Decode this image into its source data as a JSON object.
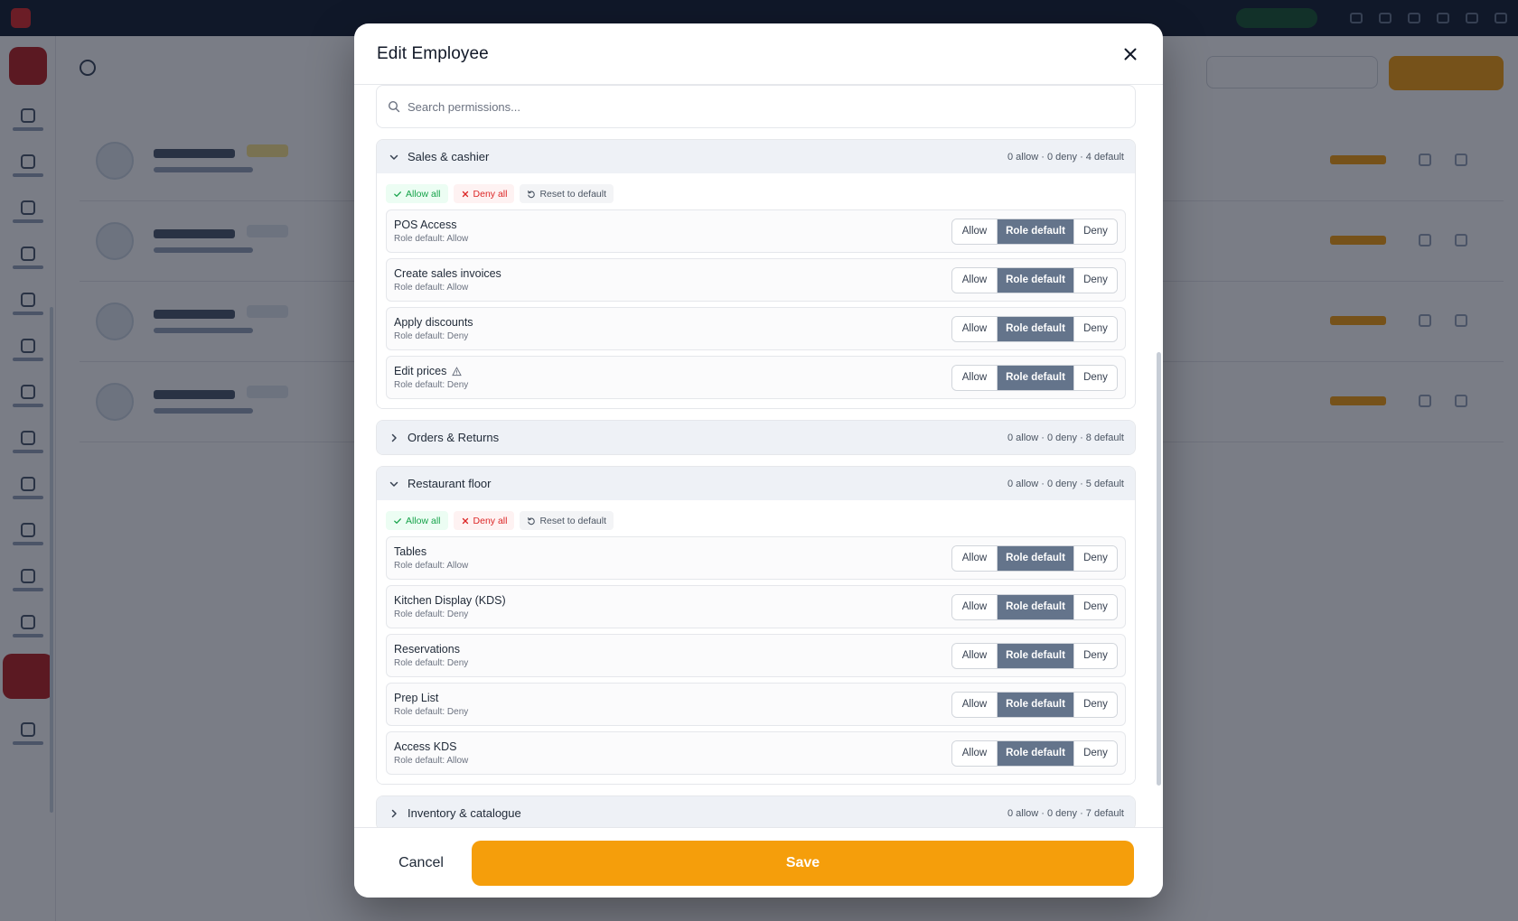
{
  "modal": {
    "title": "Edit Employee",
    "search_placeholder": "Search permissions...",
    "cancel_label": "Cancel",
    "save_label": "Save"
  },
  "colors": {
    "accent": "#f59e0b",
    "role_default_active": "#64748b",
    "allow_green": "#16a34a",
    "deny_red": "#dc2626"
  },
  "labels": {
    "allow_all": "Allow all",
    "deny_all": "Deny all",
    "reset": "Reset to default",
    "seg_allow": "Allow",
    "seg_role": "Role default",
    "seg_deny": "Deny"
  },
  "sections": [
    {
      "title": "Sales & cashier",
      "expanded": true,
      "summary": "0 allow · 0 deny · 4 default",
      "perms": [
        {
          "name": "POS Access",
          "default": "Role default: Allow",
          "warning": false,
          "selected": "role"
        },
        {
          "name": "Create sales invoices",
          "default": "Role default: Allow",
          "warning": false,
          "selected": "role"
        },
        {
          "name": "Apply discounts",
          "default": "Role default: Deny",
          "warning": false,
          "selected": "role"
        },
        {
          "name": "Edit prices",
          "default": "Role default: Deny",
          "warning": true,
          "selected": "role"
        }
      ]
    },
    {
      "title": "Orders & Returns",
      "expanded": false,
      "summary": "0 allow · 0 deny · 8 default",
      "perms": []
    },
    {
      "title": "Restaurant floor",
      "expanded": true,
      "summary": "0 allow · 0 deny · 5 default",
      "perms": [
        {
          "name": "Tables",
          "default": "Role default: Allow",
          "warning": false,
          "selected": "role"
        },
        {
          "name": "Kitchen Display (KDS)",
          "default": "Role default: Deny",
          "warning": false,
          "selected": "role"
        },
        {
          "name": "Reservations",
          "default": "Role default: Deny",
          "warning": false,
          "selected": "role"
        },
        {
          "name": "Prep List",
          "default": "Role default: Deny",
          "warning": false,
          "selected": "role"
        },
        {
          "name": "Access KDS",
          "default": "Role default: Allow",
          "warning": false,
          "selected": "role"
        }
      ]
    },
    {
      "title": "Inventory & catalogue",
      "expanded": false,
      "summary": "0 allow · 0 deny · 7 default",
      "perms": []
    }
  ]
}
